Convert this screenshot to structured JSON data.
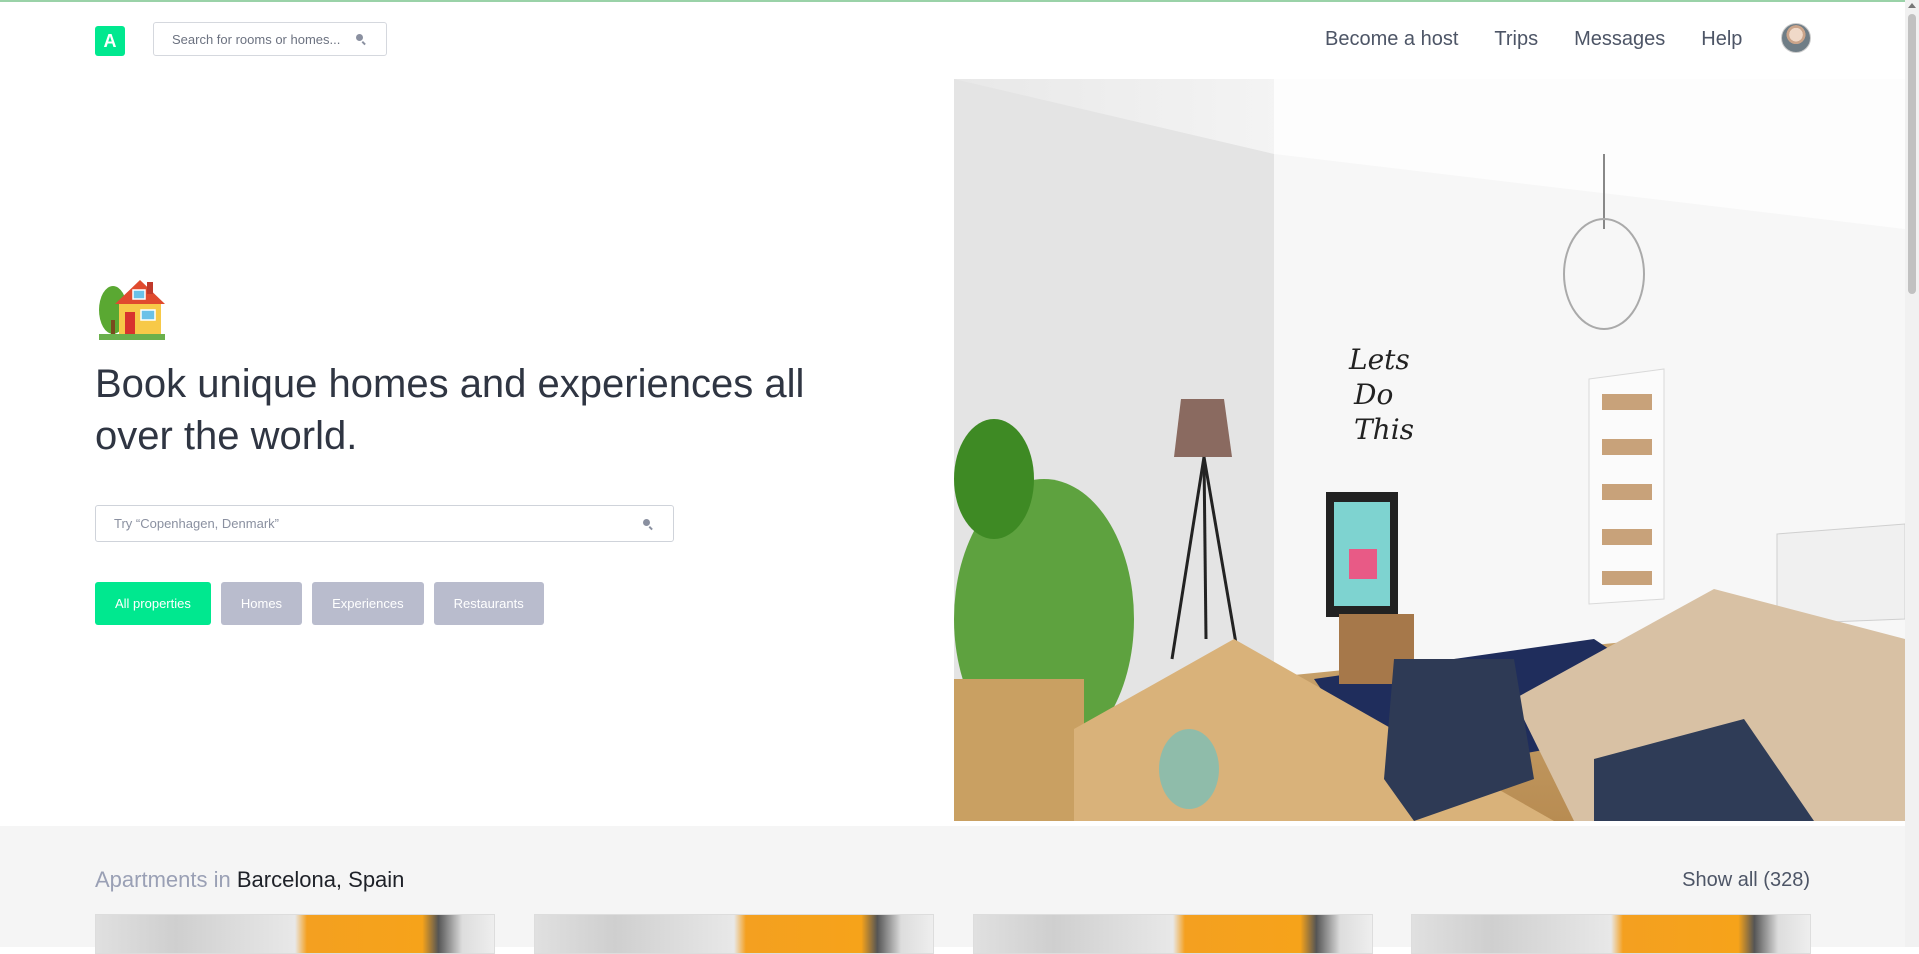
{
  "colors": {
    "brand": "#00e88f",
    "filter_inactive": "#b9bccd",
    "section_bg": "#f5f5f5"
  },
  "header": {
    "logo_letter": "A",
    "search_placeholder": "Search for rooms or homes...",
    "nav": [
      "Become a host",
      "Trips",
      "Messages",
      "Help"
    ],
    "avatar": "user-avatar"
  },
  "hero": {
    "icon": "house-with-garden-icon",
    "headline": "Book unique homes and experiences all over the world.",
    "search_placeholder": "Try “Copenhagen, Denmark”",
    "filters": [
      {
        "label": "All properties",
        "active": true
      },
      {
        "label": "Homes",
        "active": false
      },
      {
        "label": "Experiences",
        "active": false
      },
      {
        "label": "Restaurants",
        "active": false
      }
    ],
    "image": "bright-room-with-bed-chairs-plant-lamp-and-lets-do-this-wall-text"
  },
  "listing_section": {
    "title_prefix": "Apartments in",
    "title_location": "Barcelona, Spain",
    "show_all": "Show all (328)",
    "cards": 4
  }
}
